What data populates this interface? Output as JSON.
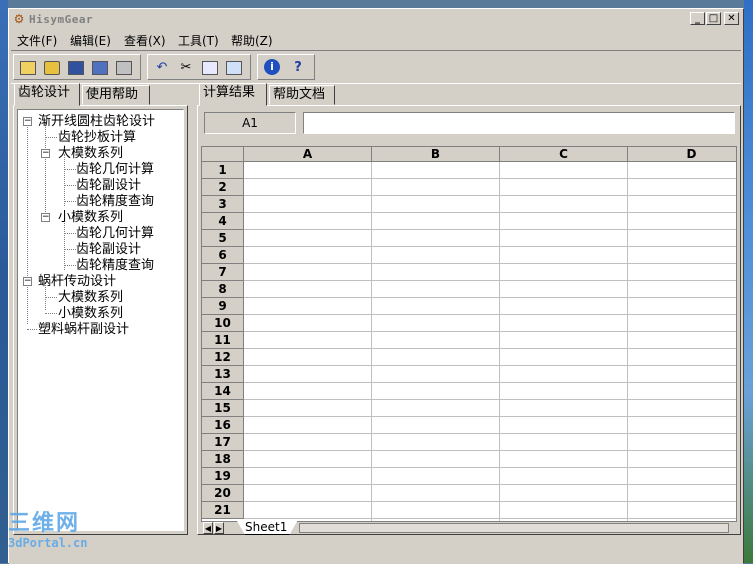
{
  "window": {
    "title": "HisymGear",
    "controls": {
      "minimize": "_",
      "maximize": "□",
      "close": "✕"
    }
  },
  "menu": [
    {
      "label": "文件(F)"
    },
    {
      "label": "编辑(E)"
    },
    {
      "label": "查看(X)"
    },
    {
      "label": "工具(T)"
    },
    {
      "label": "帮助(Z)"
    }
  ],
  "toolbar": {
    "icons": [
      "new-file-icon",
      "open-folder-icon",
      "save-icon",
      "save-all-icon",
      "print-icon",
      "undo-icon",
      "cut-icon",
      "copy-icon",
      "find-icon",
      "info-icon",
      "help-icon"
    ]
  },
  "left_tabs": [
    {
      "label": "齿轮设计"
    },
    {
      "label": "使用帮助"
    }
  ],
  "tree": [
    {
      "label": "渐开线圆柱齿轮设计",
      "level": 0,
      "expander": "−"
    },
    {
      "label": "齿轮抄板计算",
      "level": 1
    },
    {
      "label": "大模数系列",
      "level": 1,
      "expander": "−"
    },
    {
      "label": "齿轮几何计算",
      "level": 2
    },
    {
      "label": "齿轮副设计",
      "level": 2
    },
    {
      "label": "齿轮精度查询",
      "level": 2
    },
    {
      "label": "小模数系列",
      "level": 1,
      "expander": "−"
    },
    {
      "label": "齿轮几何计算",
      "level": 2
    },
    {
      "label": "齿轮副设计",
      "level": 2
    },
    {
      "label": "齿轮精度查询",
      "level": 2
    },
    {
      "label": "蜗杆传动设计",
      "level": 0,
      "expander": "−"
    },
    {
      "label": "大模数系列",
      "level": 1
    },
    {
      "label": "小模数系列",
      "level": 1
    },
    {
      "label": "塑料蜗杆副设计",
      "level": 0
    }
  ],
  "right_tabs": [
    {
      "label": "计算结果"
    },
    {
      "label": "帮助文档"
    }
  ],
  "spreadsheet": {
    "cell_ref": "A1",
    "formula_value": "",
    "columns": [
      "A",
      "B",
      "C",
      "D"
    ],
    "rows": [
      "1",
      "2",
      "3",
      "4",
      "5",
      "6",
      "7",
      "8",
      "9",
      "10",
      "11",
      "12",
      "13",
      "14",
      "15",
      "16",
      "17",
      "18",
      "19",
      "20",
      "21"
    ],
    "sheet_tab": "Sheet1"
  },
  "watermark": {
    "line1": "三维网",
    "line2": "3dPortal.cn"
  }
}
